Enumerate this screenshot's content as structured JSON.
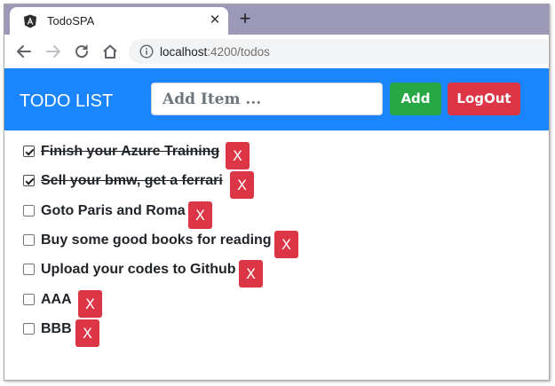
{
  "browser": {
    "tab_title": "TodoSPA",
    "tab_close": "✕",
    "new_tab": "+",
    "url_host": "localhost",
    "url_path": ":4200/todos"
  },
  "header": {
    "title": "TODO LIST",
    "input_placeholder": "Add Item ...",
    "add_label": "Add",
    "logout_label": "LogOut"
  },
  "todos": [
    {
      "text": "Finish your Azure Training",
      "done": true,
      "delete_label": "X"
    },
    {
      "text": "Sell your bmw, get a ferrari",
      "done": true,
      "delete_label": "X"
    },
    {
      "text": "Goto Paris and Roma",
      "done": false,
      "delete_label": "X"
    },
    {
      "text": "Buy some good books for reading",
      "done": false,
      "delete_label": "X"
    },
    {
      "text": "Upload your codes to Github",
      "done": false,
      "delete_label": "X"
    },
    {
      "text": "AAA",
      "done": false,
      "delete_label": "X"
    },
    {
      "text": "BBB",
      "done": false,
      "delete_label": "X"
    }
  ],
  "colors": {
    "header_bg": "#1a85ff",
    "add_button": "#28a745",
    "danger": "#dc3545",
    "tabstrip": "#9b98b8"
  }
}
